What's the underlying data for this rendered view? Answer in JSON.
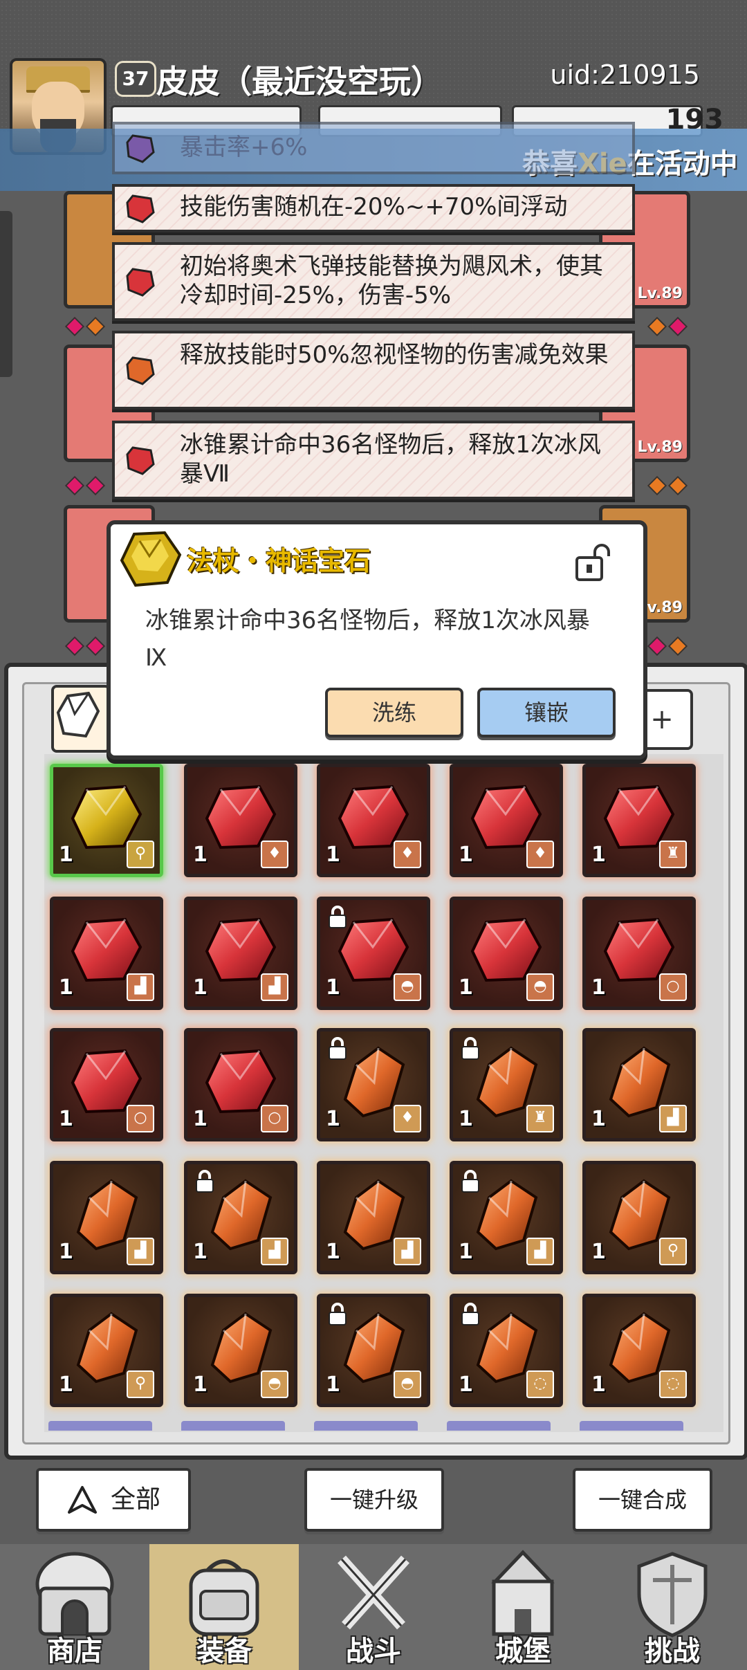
{
  "player": {
    "level": "37",
    "name": "皮皮（最近没空玩）",
    "uid": "uid:210915",
    "currency_partial": "193"
  },
  "marquee": {
    "prefix": "恭喜",
    "highlight": "Xie",
    "suffix": "在活动中"
  },
  "equipment_levels": [
    "Lv.89",
    "Lv.89",
    "Lv.89"
  ],
  "affixes": [
    {
      "text": "暴击率+6%",
      "color": "purple"
    },
    {
      "text": "技能伤害随机在-20%~+70%间浮动",
      "color": "red"
    },
    {
      "text": "初始将奥术飞弹技能替换为飓风术，使其冷却时间-25%，伤害-5%",
      "color": "red"
    },
    {
      "text": "释放技能时50%忽视怪物的伤害减免效果",
      "color": "orange"
    },
    {
      "text": "冰锥累计命中36名怪物后，释放1次冰风暴Ⅶ",
      "color": "red"
    }
  ],
  "gem_popup": {
    "title": "法杖・神话宝石",
    "description": "冰锥累计命中36名怪物后，释放1次冰风暴Ⅸ",
    "refine_label": "洗练",
    "inlay_label": "镶嵌"
  },
  "inventory_tab_right": "+",
  "inventory": [
    [
      {
        "gem": "gold",
        "count": "1",
        "slot": "staff",
        "locked": false
      },
      {
        "gem": "red",
        "count": "1",
        "slot": "drop",
        "locked": false
      },
      {
        "gem": "red",
        "count": "1",
        "slot": "drop",
        "locked": false
      },
      {
        "gem": "red",
        "count": "1",
        "slot": "drop",
        "locked": false
      },
      {
        "gem": "red",
        "count": "1",
        "slot": "armor",
        "locked": false
      }
    ],
    [
      {
        "gem": "red",
        "count": "1",
        "slot": "boot",
        "locked": false
      },
      {
        "gem": "red",
        "count": "1",
        "slot": "boot",
        "locked": false
      },
      {
        "gem": "red",
        "count": "1",
        "slot": "helmet",
        "locked": true
      },
      {
        "gem": "red",
        "count": "1",
        "slot": "helmet",
        "locked": false
      },
      {
        "gem": "red",
        "count": "1",
        "slot": "ring",
        "locked": false
      }
    ],
    [
      {
        "gem": "red",
        "count": "1",
        "slot": "ring",
        "locked": false
      },
      {
        "gem": "red",
        "count": "1",
        "slot": "ring",
        "locked": false
      },
      {
        "gem": "orange",
        "count": "1",
        "slot": "drop",
        "locked": true
      },
      {
        "gem": "orange",
        "count": "1",
        "slot": "armor",
        "locked": true
      },
      {
        "gem": "orange",
        "count": "1",
        "slot": "boot",
        "locked": false
      }
    ],
    [
      {
        "gem": "orange",
        "count": "1",
        "slot": "boot",
        "locked": false
      },
      {
        "gem": "orange",
        "count": "1",
        "slot": "boot",
        "locked": true
      },
      {
        "gem": "orange",
        "count": "1",
        "slot": "boot",
        "locked": false
      },
      {
        "gem": "orange",
        "count": "1",
        "slot": "boot",
        "locked": true
      },
      {
        "gem": "orange",
        "count": "1",
        "slot": "staff",
        "locked": false
      }
    ],
    [
      {
        "gem": "orange",
        "count": "1",
        "slot": "staff",
        "locked": false
      },
      {
        "gem": "orange",
        "count": "1",
        "slot": "helmet",
        "locked": false
      },
      {
        "gem": "orange",
        "count": "1",
        "slot": "helmet",
        "locked": true
      },
      {
        "gem": "orange",
        "count": "1",
        "slot": "necklace",
        "locked": true
      },
      {
        "gem": "orange",
        "count": "1",
        "slot": "necklace",
        "locked": false
      }
    ]
  ],
  "bottom_actions": {
    "filter_label": "全部",
    "upgrade_label": "一键升级",
    "merge_label": "一键合成"
  },
  "nav": [
    {
      "label": "商店",
      "icon": "shop-icon"
    },
    {
      "label": "装备",
      "icon": "backpack-icon",
      "active": true
    },
    {
      "label": "战斗",
      "icon": "crossed-swords-icon"
    },
    {
      "label": "城堡",
      "icon": "castle-icon"
    },
    {
      "label": "挑战",
      "icon": "shield-icon"
    }
  ],
  "colors": {
    "gem_red": "#d8343a",
    "gem_orange": "#e0682a",
    "gem_gold": "#d6b21a",
    "popup_title": "#e8b900",
    "refine_btn": "#fbdcb0",
    "inlay_btn": "#a6ccf2",
    "nav_active": "#d5bf88"
  }
}
